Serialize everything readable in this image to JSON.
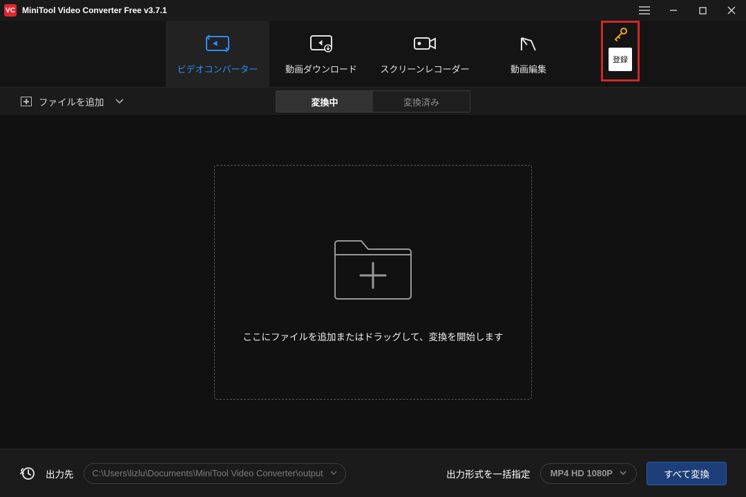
{
  "titlebar": {
    "app_icon_text": "VC",
    "title": "MiniTool Video Converter Free v3.7.1"
  },
  "register": {
    "label": "登録"
  },
  "tabs": {
    "converter": {
      "label": "ビデオコンバーター"
    },
    "download": {
      "label": "動画ダウンロード"
    },
    "recorder": {
      "label": "スクリーンレコーダー"
    },
    "editor": {
      "label": "動画編集"
    }
  },
  "toolbar": {
    "add_file_label": "ファイルを追加",
    "seg_converting": "変換中",
    "seg_converted": "変換済み"
  },
  "dropzone": {
    "hint": "ここにファイルを追加またはドラッグして、変換を開始します"
  },
  "footer": {
    "output_dir_label": "出力先",
    "output_dir_value": "C:\\Users\\lizlu\\Documents\\MiniTool Video Converter\\output",
    "format_label": "出力形式を一括指定",
    "format_value": "MP4 HD 1080P",
    "convert_all_label": "すべて変換"
  }
}
